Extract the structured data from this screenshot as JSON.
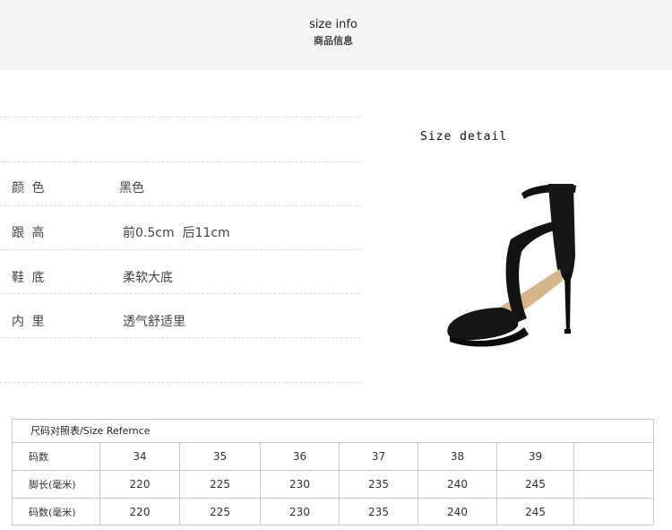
{
  "header": {
    "title_en": "size info",
    "title_cn": "商品信息"
  },
  "attributes": [
    {
      "label": "颜 色",
      "value": "黑色"
    },
    {
      "label": "跟 高",
      "value": "前0.5cm  后11cm"
    },
    {
      "label": "鞋 底",
      "value": "柔软大底"
    },
    {
      "label": "内 里",
      "value": "透气舒适里"
    }
  ],
  "detail": {
    "title": "Size detail",
    "image_icon": "high-heel-sandal-image"
  },
  "size_table": {
    "caption": "尺码对照表/Size Refernce",
    "rows": [
      {
        "label": "码数",
        "cells": [
          "34",
          "35",
          "36",
          "37",
          "38",
          "39",
          ""
        ]
      },
      {
        "label": "脚长(毫米)",
        "cells": [
          "220",
          "225",
          "230",
          "235",
          "240",
          "245",
          ""
        ]
      },
      {
        "label": "码数(毫米)",
        "cells": [
          "220",
          "225",
          "230",
          "235",
          "240",
          "245",
          ""
        ]
      }
    ]
  },
  "colors": {
    "header_bg": "#f4f4f4",
    "border": "#c9c9c9",
    "text": "#333333"
  }
}
